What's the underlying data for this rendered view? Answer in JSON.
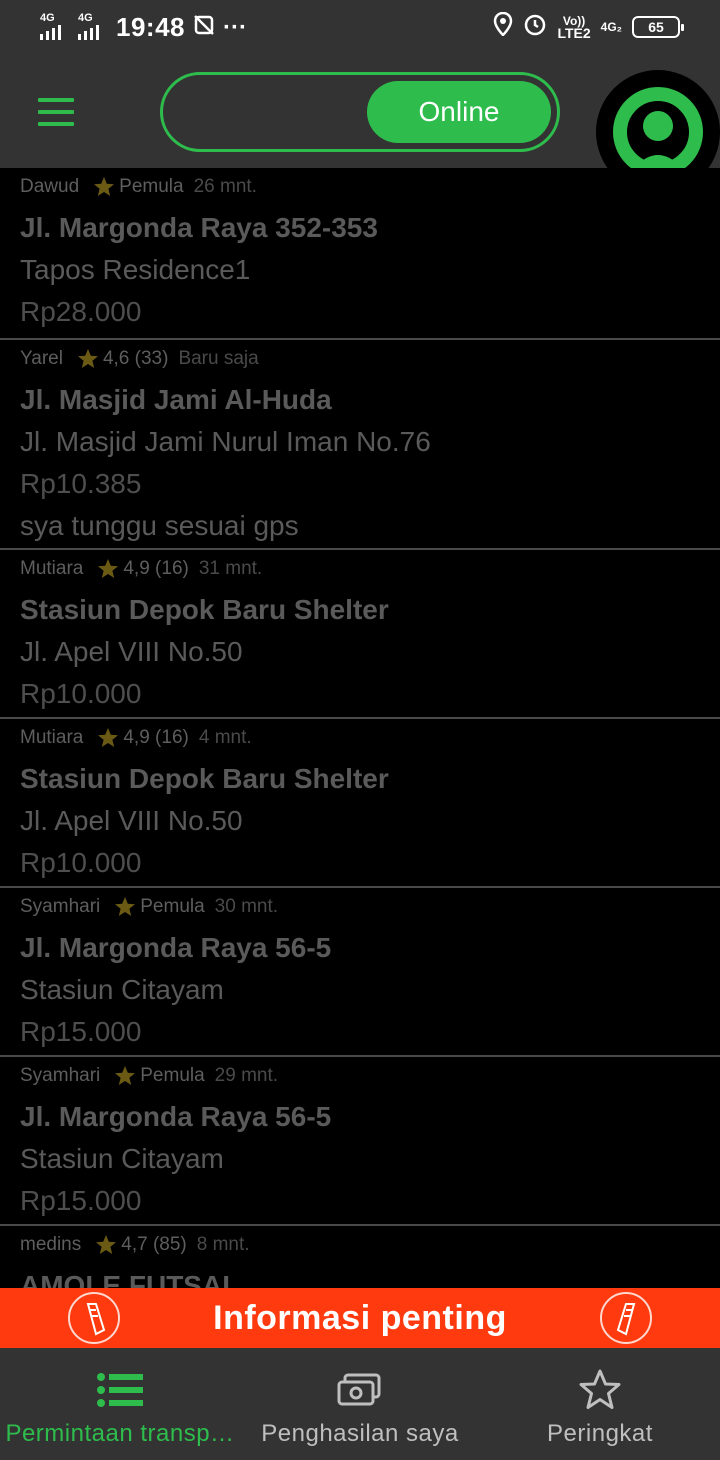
{
  "status_bar": {
    "net1": "4G",
    "net2": "4G",
    "time": "19:48",
    "dots": "···",
    "volte_top": "Vo))",
    "volte_bottom": "LTE2",
    "net3": "4G₂",
    "battery": "65"
  },
  "header": {
    "toggle_label": "Online"
  },
  "colors": {
    "accent": "#2ebd4c",
    "banner": "#ff3a0f",
    "bar_bg": "#333333",
    "star": "#6b5a14"
  },
  "requests": [
    {
      "name": "Dawud",
      "rating": "Pemula",
      "time": "26 mnt.",
      "line1": "Jl. Margonda Raya 352-353",
      "line2": "Tapos Residence1",
      "price": "Rp28.000",
      "note": ""
    },
    {
      "name": "Yarel",
      "rating": "4,6 (33)",
      "time": "Baru saja",
      "line1": "Jl. Masjid Jami  Al-Huda",
      "line2": "Jl. Masjid Jami Nurul Iman No.76",
      "price": "Rp10.385",
      "note": "sya tunggu sesuai gps"
    },
    {
      "name": "Mutiara",
      "rating": "4,9 (16)",
      "time": "31 mnt.",
      "line1": "Stasiun Depok Baru Shelter",
      "line2": "Jl. Apel VIII No.50",
      "price": "Rp10.000",
      "note": ""
    },
    {
      "name": "Mutiara",
      "rating": "4,9 (16)",
      "time": "4 mnt.",
      "line1": "Stasiun Depok Baru Shelter",
      "line2": "Jl. Apel VIII No.50",
      "price": "Rp10.000",
      "note": ""
    },
    {
      "name": "Syamhari",
      "rating": "Pemula",
      "time": "30 mnt.",
      "line1": "Jl. Margonda Raya 56-5",
      "line2": "Stasiun Citayam",
      "price": "Rp15.000",
      "note": ""
    },
    {
      "name": "Syamhari",
      "rating": "Pemula",
      "time": "29 mnt.",
      "line1": "Jl. Margonda Raya 56-5",
      "line2": "Stasiun Citayam",
      "price": "Rp15.000",
      "note": ""
    },
    {
      "name": "medins",
      "rating": "4,7 (85)",
      "time": "8 mnt.",
      "line1": "AMOLE FUTSAL",
      "line2": "",
      "price": "",
      "note": ""
    }
  ],
  "banner": {
    "text": "Informasi penting"
  },
  "bottom_nav": [
    {
      "label": "Permintaan transp…",
      "icon": "list-icon",
      "active": true
    },
    {
      "label": "Penghasilan saya",
      "icon": "money-icon",
      "active": false
    },
    {
      "label": "Peringkat",
      "icon": "star-outline-icon",
      "active": false
    }
  ]
}
